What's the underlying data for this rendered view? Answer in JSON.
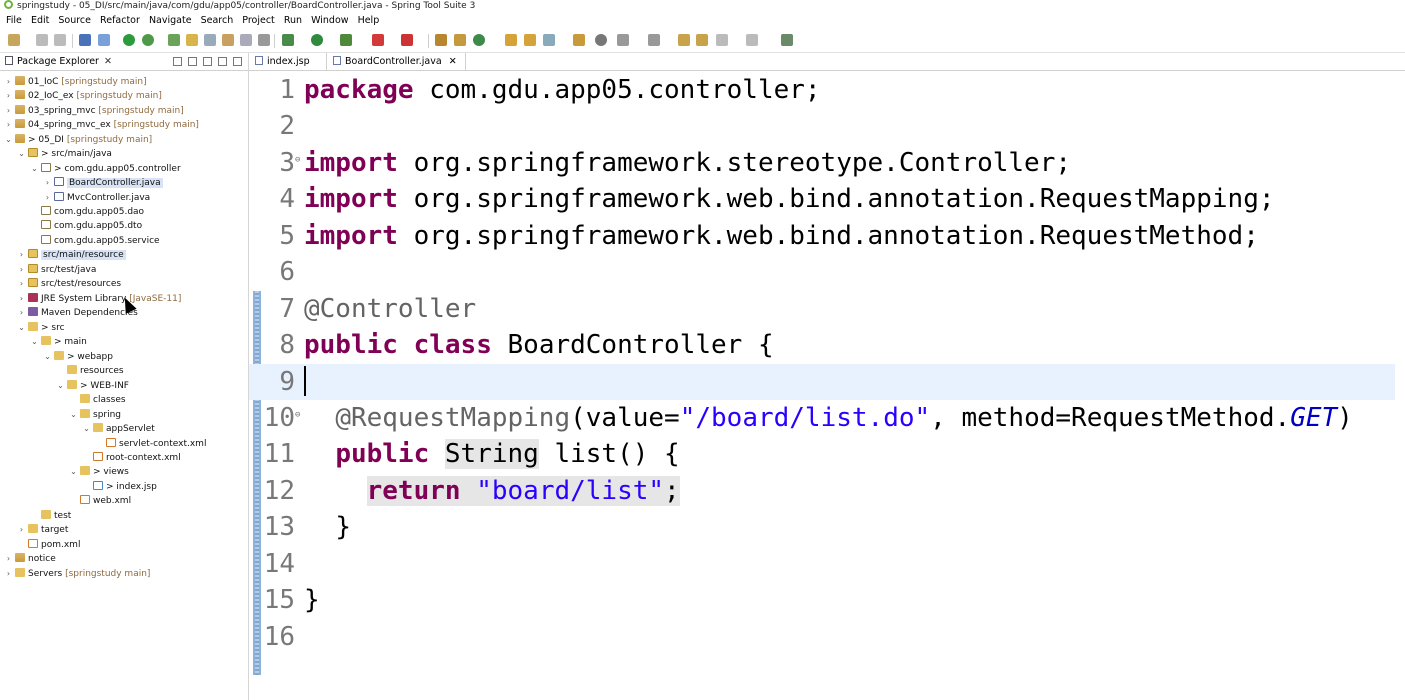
{
  "window": {
    "title": "springstudy - 05_DI/src/main/java/com/gdu/app05/controller/BoardController.java - Spring Tool Suite 3"
  },
  "menu": [
    "File",
    "Edit",
    "Source",
    "Refactor",
    "Navigate",
    "Search",
    "Project",
    "Run",
    "Window",
    "Help"
  ],
  "explorer": {
    "tab_label": "Package Explorer",
    "close_glyph": "✕",
    "items": [
      {
        "label": "01_IoC",
        "dec": "[springstudy main]"
      },
      {
        "label": "02_IoC_ex",
        "dec": "[springstudy main]"
      },
      {
        "label": "03_spring_mvc",
        "dec": "[springstudy main]"
      },
      {
        "label": "04_spring_mvc_ex",
        "dec": "[springstudy main]"
      },
      {
        "label": "> 05_DI",
        "dec": "[springstudy main]"
      },
      {
        "label": "> src/main/java",
        "dec": ""
      },
      {
        "label": "> com.gdu.app05.controller",
        "dec": ""
      },
      {
        "label": "BoardController.java",
        "dec": ""
      },
      {
        "label": "MvcController.java",
        "dec": ""
      },
      {
        "label": "com.gdu.app05.dao",
        "dec": ""
      },
      {
        "label": "com.gdu.app05.dto",
        "dec": ""
      },
      {
        "label": "com.gdu.app05.service",
        "dec": ""
      },
      {
        "label": "src/main/resource",
        "dec": ""
      },
      {
        "label": "src/test/java",
        "dec": ""
      },
      {
        "label": "src/test/resources",
        "dec": ""
      },
      {
        "label": "JRE System Library",
        "dec": "[JavaSE-11]"
      },
      {
        "label": "Maven Dependencies",
        "dec": ""
      },
      {
        "label": "> src",
        "dec": ""
      },
      {
        "label": "> main",
        "dec": ""
      },
      {
        "label": "> webapp",
        "dec": ""
      },
      {
        "label": "resources",
        "dec": ""
      },
      {
        "label": "> WEB-INF",
        "dec": ""
      },
      {
        "label": "classes",
        "dec": ""
      },
      {
        "label": "spring",
        "dec": ""
      },
      {
        "label": "appServlet",
        "dec": ""
      },
      {
        "label": "servlet-context.xml",
        "dec": ""
      },
      {
        "label": "root-context.xml",
        "dec": ""
      },
      {
        "label": "> views",
        "dec": ""
      },
      {
        "label": "> index.jsp",
        "dec": ""
      },
      {
        "label": "web.xml",
        "dec": ""
      },
      {
        "label": "test",
        "dec": ""
      },
      {
        "label": "target",
        "dec": ""
      },
      {
        "label": "pom.xml",
        "dec": ""
      },
      {
        "label": "notice",
        "dec": ""
      },
      {
        "label": "Servers",
        "dec": "[springstudy main]"
      }
    ]
  },
  "editor": {
    "tabs": [
      {
        "label": "index.jsp"
      },
      {
        "label": "BoardController.java",
        "close": "✕"
      }
    ],
    "line_numbers": [
      "1",
      "2",
      "3",
      "4",
      "5",
      "6",
      "7",
      "8",
      "9",
      "10",
      "11",
      "12",
      "13",
      "14",
      "15",
      "16"
    ],
    "code": {
      "l1_kw": "package",
      "l1_rest": " com.gdu.app05.controller;",
      "l3_kw": "import",
      "l3_rest": " org.springframework.stereotype.Controller;",
      "l4_kw": "import",
      "l4_rest": " org.springframework.web.bind.annotation.RequestMapping;",
      "l5_kw": "import",
      "l5_rest": " org.springframework.web.bind.annotation.RequestMethod;",
      "l7_ann": "@Controller",
      "l8_kw1": "public",
      "l8_kw2": "class",
      "l8_rest": " BoardController {",
      "l10_ann": "@RequestMapping",
      "l10_a": "(value=",
      "l10_str": "\"/board/list.do\"",
      "l10_b": ", method=RequestMethod.",
      "l10_stat": "GET",
      "l10_c": ")",
      "l11_kw": "public",
      "l11_type": "String",
      "l11_rest": " list() {",
      "l12_kw": "return",
      "l12_str": "\"board/list\"",
      "l12_end": ";",
      "l13": "}",
      "l15": "}"
    }
  }
}
